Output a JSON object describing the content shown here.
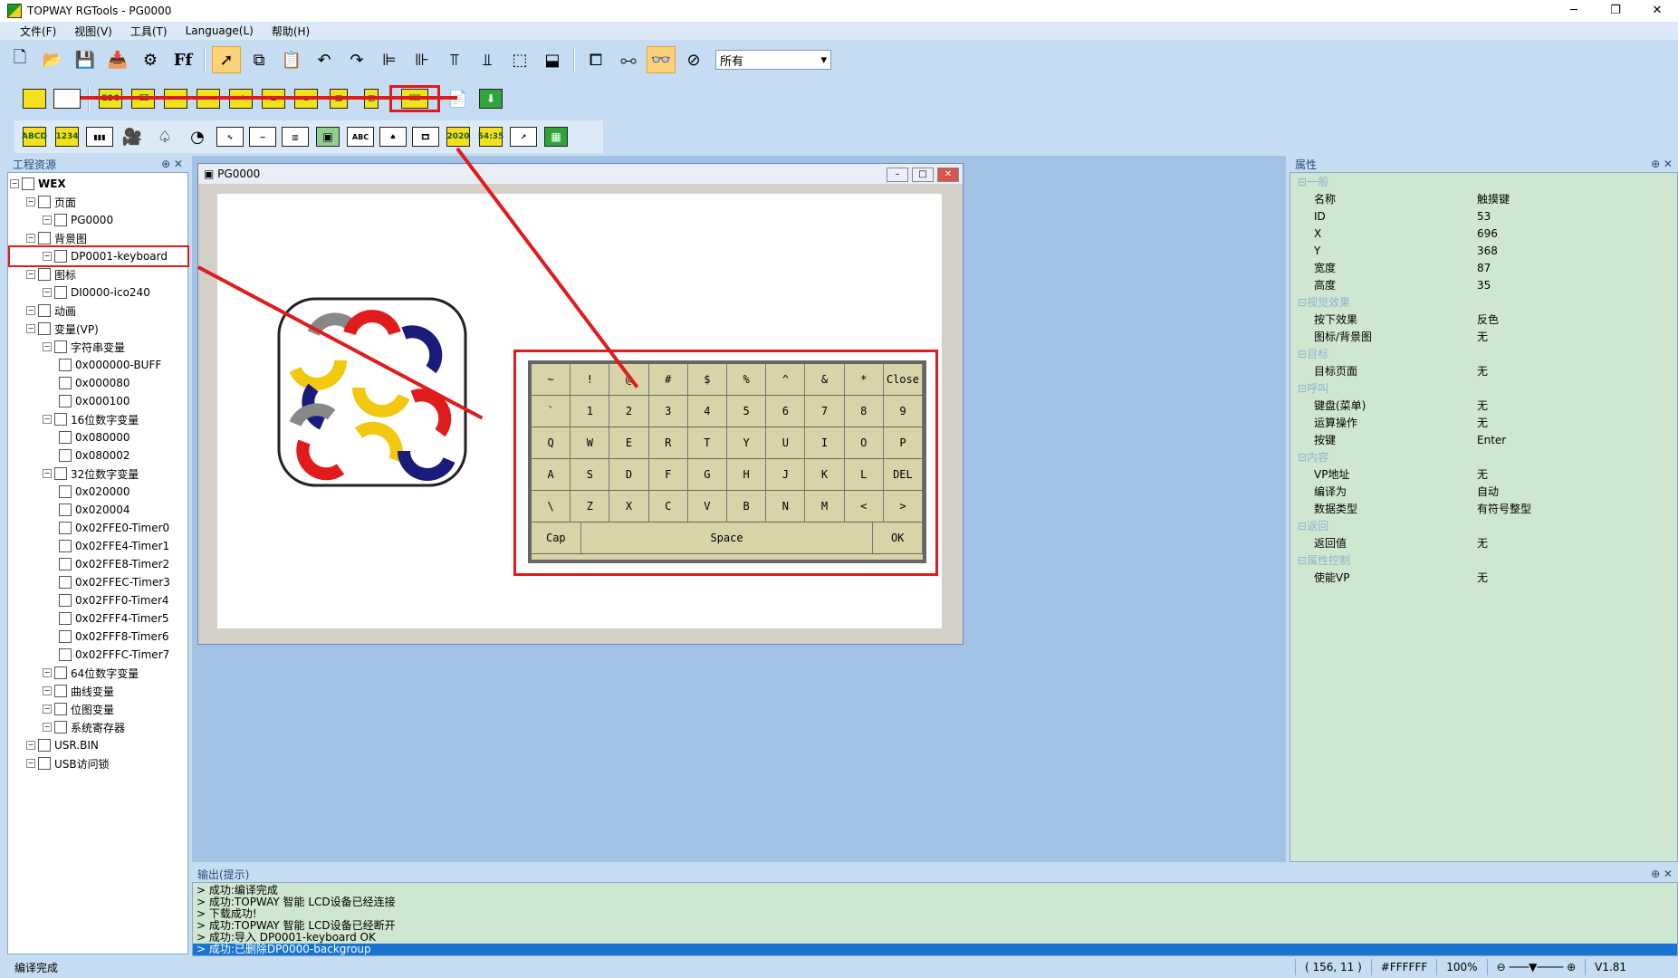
{
  "window": {
    "title": "TOPWAY RGTools - PG0000",
    "controls": [
      "─",
      "❐",
      "✕"
    ]
  },
  "menu": [
    "文件(F)",
    "视图(V)",
    "工具(T)",
    "Language(L)",
    "帮助(H)"
  ],
  "toolbar": {
    "combo_value": "所有"
  },
  "left_panel": {
    "title": "工程资源"
  },
  "tree": [
    {
      "label": "WEX",
      "level": 0,
      "bold": true
    },
    {
      "label": "页面",
      "level": 1
    },
    {
      "label": "PG0000",
      "level": 2
    },
    {
      "label": "背景图",
      "level": 1
    },
    {
      "label": "DP0001-keyboard",
      "level": 2,
      "selected": true
    },
    {
      "label": "图标",
      "level": 1
    },
    {
      "label": "DI0000-ico240",
      "level": 2
    },
    {
      "label": "动画",
      "level": 1
    },
    {
      "label": "变量(VP)",
      "level": 1
    },
    {
      "label": "字符串变量",
      "level": 2
    },
    {
      "label": "0x000000-BUFF",
      "level": 3
    },
    {
      "label": "0x000080",
      "level": 3
    },
    {
      "label": "0x000100",
      "level": 3
    },
    {
      "label": "16位数字变量",
      "level": 2
    },
    {
      "label": "0x080000",
      "level": 3
    },
    {
      "label": "0x080002",
      "level": 3
    },
    {
      "label": "32位数字变量",
      "level": 2
    },
    {
      "label": "0x020000",
      "level": 3
    },
    {
      "label": "0x020004",
      "level": 3
    },
    {
      "label": "0x02FFE0-Timer0",
      "level": 3
    },
    {
      "label": "0x02FFE4-Timer1",
      "level": 3
    },
    {
      "label": "0x02FFE8-Timer2",
      "level": 3
    },
    {
      "label": "0x02FFEC-Timer3",
      "level": 3
    },
    {
      "label": "0x02FFF0-Timer4",
      "level": 3
    },
    {
      "label": "0x02FFF4-Timer5",
      "level": 3
    },
    {
      "label": "0x02FFF8-Timer6",
      "level": 3
    },
    {
      "label": "0x02FFFC-Timer7",
      "level": 3
    },
    {
      "label": "64位数字变量",
      "level": 2
    },
    {
      "label": "曲线变量",
      "level": 2
    },
    {
      "label": "位图变量",
      "level": 2
    },
    {
      "label": "系统寄存器",
      "level": 2
    },
    {
      "label": "USR.BIN",
      "level": 1
    },
    {
      "label": "USB访问锁",
      "level": 1
    }
  ],
  "document": {
    "title": "PG0000"
  },
  "keyboard_rows": [
    [
      "~",
      "!",
      "@",
      "#",
      "$",
      "%",
      "^",
      "&",
      "*",
      "Close"
    ],
    [
      "`",
      "1",
      "2",
      "3",
      "4",
      "5",
      "6",
      "7",
      "8",
      "9"
    ],
    [
      "Q",
      "W",
      "E",
      "R",
      "T",
      "Y",
      "U",
      "I",
      "O",
      "P"
    ],
    [
      "A",
      "S",
      "D",
      "F",
      "G",
      "H",
      "J",
      "K",
      "L",
      "DEL"
    ],
    [
      "\\",
      "Z",
      "X",
      "C",
      "V",
      "B",
      "N",
      "M",
      "<",
      ">"
    ],
    [
      "Cap",
      "Space",
      "OK"
    ]
  ],
  "properties_panel": {
    "title": "属性"
  },
  "properties": [
    {
      "cat": "一般"
    },
    {
      "k": "名称",
      "v": "触摸键"
    },
    {
      "k": "ID",
      "v": "53"
    },
    {
      "k": "X",
      "v": "696"
    },
    {
      "k": "Y",
      "v": "368"
    },
    {
      "k": "宽度",
      "v": "87"
    },
    {
      "k": "高度",
      "v": "35"
    },
    {
      "cat": "视觉效果"
    },
    {
      "k": "按下效果",
      "v": "反色"
    },
    {
      "k": "图标/背景图",
      "v": "无"
    },
    {
      "cat": "目标"
    },
    {
      "k": "目标页面",
      "v": "无"
    },
    {
      "cat": "呼叫"
    },
    {
      "k": "键盘(菜单)",
      "v": "无"
    },
    {
      "k": "运算操作",
      "v": "无"
    },
    {
      "k": "按键",
      "v": "Enter"
    },
    {
      "cat": "内容"
    },
    {
      "k": "VP地址",
      "v": "无"
    },
    {
      "k": "编译为",
      "v": "自动"
    },
    {
      "k": "数据类型",
      "v": "有符号整型"
    },
    {
      "cat": "返回"
    },
    {
      "k": "返回值",
      "v": "无"
    },
    {
      "cat": "属性控制"
    },
    {
      "k": "使能VP",
      "v": "无"
    }
  ],
  "output": {
    "title": "输出(提示)",
    "lines": [
      "> 成功:编译完成",
      "> 成功:TOPWAY 智能 LCD设备已经连接",
      "> 下载成功!",
      "> 成功:TOPWAY 智能 LCD设备已经断开",
      "> 成功:导入 DP0001-keyboard OK",
      "> 成功:已删除DP0000-backgroup"
    ]
  },
  "status": {
    "left": "编译完成",
    "coords": "( 156, 11 )",
    "color": "#FFFFFF",
    "zoom": "100%",
    "version": "V1.81"
  }
}
